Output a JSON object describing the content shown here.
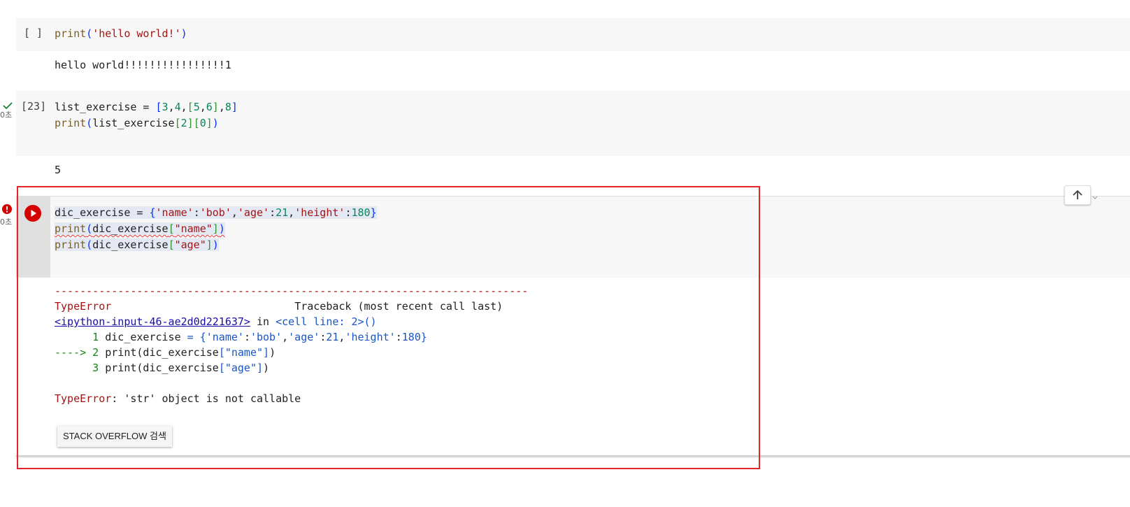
{
  "cell1": {
    "prompt": "[ ]",
    "code_lines": [
      [
        {
          "t": "print",
          "c": "kw"
        },
        {
          "t": "(",
          "c": "br"
        },
        {
          "t": "'hello world!'",
          "c": "str"
        },
        {
          "t": ")",
          "c": "br"
        }
      ]
    ],
    "output": "hello world!!!!!!!!!!!!!!!!1"
  },
  "cell2": {
    "prompt": "[23]",
    "time": "0초",
    "status_icon": "check-icon",
    "code_lines": [
      [
        {
          "t": "list_exercise = ",
          "c": ""
        },
        {
          "t": "[",
          "c": "br"
        },
        {
          "t": "3",
          "c": "num"
        },
        {
          "t": ",",
          "c": ""
        },
        {
          "t": "4",
          "c": "num"
        },
        {
          "t": ",",
          "c": ""
        },
        {
          "t": "[",
          "c": "br2"
        },
        {
          "t": "5",
          "c": "num"
        },
        {
          "t": ",",
          "c": ""
        },
        {
          "t": "6",
          "c": "num"
        },
        {
          "t": "]",
          "c": "br2"
        },
        {
          "t": ",",
          "c": ""
        },
        {
          "t": "8",
          "c": "num"
        },
        {
          "t": "]",
          "c": "br"
        }
      ],
      [
        {
          "t": "print",
          "c": "kw"
        },
        {
          "t": "(",
          "c": "br"
        },
        {
          "t": "list_exercise",
          "c": ""
        },
        {
          "t": "[",
          "c": "br2"
        },
        {
          "t": "2",
          "c": "num"
        },
        {
          "t": "]",
          "c": "br2"
        },
        {
          "t": "[",
          "c": "br2"
        },
        {
          "t": "0",
          "c": "num"
        },
        {
          "t": "]",
          "c": "br2"
        },
        {
          "t": ")",
          "c": "br"
        }
      ]
    ],
    "output": "5"
  },
  "cell3": {
    "time": "0초",
    "status_icon": "error-icon",
    "run_icon": "play-icon",
    "code_lines": [
      [
        {
          "t": "dic_exercise = ",
          "c": ""
        },
        {
          "t": "{",
          "c": "br"
        },
        {
          "t": "'name'",
          "c": "str"
        },
        {
          "t": ":",
          "c": ""
        },
        {
          "t": "'bob'",
          "c": "str"
        },
        {
          "t": ",",
          "c": ""
        },
        {
          "t": "'age'",
          "c": "str"
        },
        {
          "t": ":",
          "c": ""
        },
        {
          "t": "21",
          "c": "num"
        },
        {
          "t": ",",
          "c": ""
        },
        {
          "t": "'height'",
          "c": "str"
        },
        {
          "t": ":",
          "c": ""
        },
        {
          "t": "180",
          "c": "num"
        },
        {
          "t": "}",
          "c": "br"
        }
      ],
      [
        {
          "t": "print",
          "c": "kw"
        },
        {
          "t": "(",
          "c": "br"
        },
        {
          "t": "dic_exercise",
          "c": ""
        },
        {
          "t": "[",
          "c": "br2"
        },
        {
          "t": "\"name\"",
          "c": "str"
        },
        {
          "t": "]",
          "c": "br2"
        },
        {
          "t": ")",
          "c": "br"
        }
      ],
      [
        {
          "t": "print",
          "c": "kw"
        },
        {
          "t": "(",
          "c": "br"
        },
        {
          "t": "dic_exercise",
          "c": ""
        },
        {
          "t": "[",
          "c": "br2"
        },
        {
          "t": "\"age\"",
          "c": "str"
        },
        {
          "t": "]",
          "c": "br2"
        },
        {
          "t": ")",
          "c": "br"
        }
      ]
    ],
    "traceback": {
      "dashes": "---------------------------------------------------------------------------",
      "error_name": "TypeError",
      "traceback_title": "Traceback (most recent call last)",
      "input_link": "<ipython-input-46-ae2d0d221637>",
      "in_text": " in ",
      "cell_line": "<cell line: 2>()",
      "lines": [
        {
          "marker": "      1 ",
          "code": [
            {
              "t": "dic_exercise ",
              "c": ""
            },
            {
              "t": "= {",
              "c": "blu"
            },
            {
              "t": "'name'",
              "c": "blu"
            },
            {
              "t": ":",
              "c": ""
            },
            {
              "t": "'bob'",
              "c": "blu"
            },
            {
              "t": ",",
              "c": ""
            },
            {
              "t": "'age'",
              "c": "blu"
            },
            {
              "t": ":",
              "c": ""
            },
            {
              "t": "21",
              "c": "blu"
            },
            {
              "t": ",",
              "c": ""
            },
            {
              "t": "'height'",
              "c": "blu"
            },
            {
              "t": ":",
              "c": ""
            },
            {
              "t": "180}",
              "c": "blu"
            }
          ]
        },
        {
          "marker": "----> 2 ",
          "code": [
            {
              "t": "print(dic_exercise",
              "c": ""
            },
            {
              "t": "[\"name\"]",
              "c": "blu"
            },
            {
              "t": ")",
              "c": ""
            }
          ]
        },
        {
          "marker": "      3 ",
          "code": [
            {
              "t": "print(dic_exercise",
              "c": ""
            },
            {
              "t": "[\"age\"]",
              "c": "blu"
            },
            {
              "t": ")",
              "c": ""
            }
          ]
        }
      ],
      "final_name": "TypeError",
      "final_msg": ": 'str' object is not callable"
    },
    "so_button": "STACK OVERFLOW 검색"
  },
  "toolbar": {
    "move_up_icon": "arrow-up-icon"
  },
  "colors": {
    "highlight_box": "#e3242b",
    "error_red": "#d50000",
    "check_green": "#188038"
  }
}
